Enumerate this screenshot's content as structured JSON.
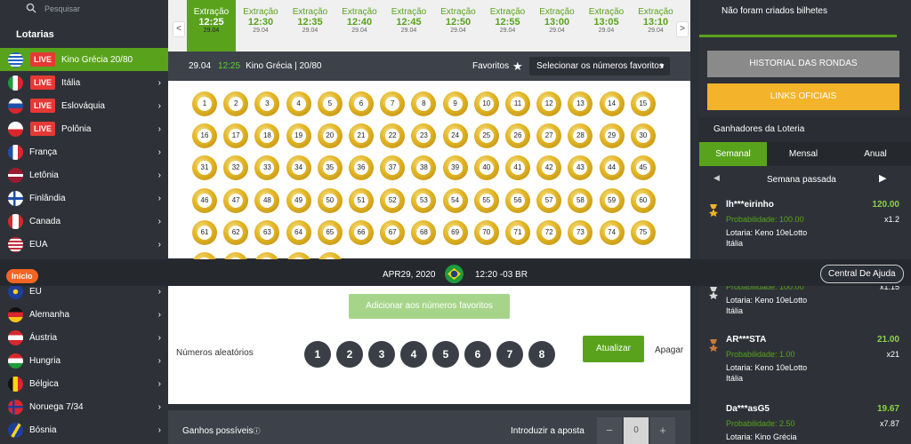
{
  "search": {
    "placeholder": "Pesquisar"
  },
  "sidebar": {
    "title": "Lotarias",
    "items": [
      {
        "name": "Kino Grécia 20/80",
        "live": "LIVE",
        "flag": "gr",
        "active": true
      },
      {
        "name": "Itália",
        "live": "LIVE",
        "flag": "it"
      },
      {
        "name": "Eslováquia",
        "live": "LIVE",
        "flag": "sk"
      },
      {
        "name": "Polônia",
        "live": "LIVE",
        "flag": "pl"
      },
      {
        "name": "França",
        "flag": "fr"
      },
      {
        "name": "Letônia",
        "flag": "lv"
      },
      {
        "name": "Finlândia",
        "flag": "fi"
      },
      {
        "name": "Canada",
        "flag": "ca"
      },
      {
        "name": "EUA",
        "flag": "us"
      },
      {
        "name": "EU",
        "flag": "eu"
      },
      {
        "name": "Alemanha",
        "flag": "de"
      },
      {
        "name": "Áustria",
        "flag": "at"
      },
      {
        "name": "Hungria",
        "flag": "hu"
      },
      {
        "name": "Bélgica",
        "flag": "be"
      },
      {
        "name": "Noruega 7/34",
        "flag": "no"
      },
      {
        "name": "Bósnia",
        "flag": "ba"
      }
    ]
  },
  "draws": [
    {
      "label": "Extração",
      "time": "12:25",
      "date": "29.04",
      "current": true
    },
    {
      "label": "Extração",
      "time": "12:30",
      "date": "29.04"
    },
    {
      "label": "Extração",
      "time": "12:35",
      "date": "29.04"
    },
    {
      "label": "Extração",
      "time": "12:40",
      "date": "29.04"
    },
    {
      "label": "Extração",
      "time": "12:45",
      "date": "29.04"
    },
    {
      "label": "Extração",
      "time": "12:50",
      "date": "29.04"
    },
    {
      "label": "Extração",
      "time": "12:55",
      "date": "29.04"
    },
    {
      "label": "Extração",
      "time": "13:00",
      "date": "29.04"
    },
    {
      "label": "Extração",
      "time": "13:05",
      "date": "29.04"
    },
    {
      "label": "Extração",
      "time": "13:10",
      "date": "29.04"
    }
  ],
  "nav": {
    "prev": "<",
    "next": ">"
  },
  "gamebar": {
    "date": "29.04",
    "time": "12:25",
    "name": "Kino Grécia | 20/80",
    "favorites": "Favoritos",
    "select_favorites": "Selecionar os números favoritos"
  },
  "balls": {
    "count": 80
  },
  "statusbar": {
    "inicio": "Início",
    "date": "APR29, 2020",
    "time": "12:20 -03 BR",
    "help": "Central De Ajuda"
  },
  "lower": {
    "add_favorites": "Adicionar aos números favoritos",
    "random_label": "Números aleatórios",
    "random_numbers": [
      "1",
      "2",
      "3",
      "4",
      "5",
      "6",
      "7",
      "8"
    ],
    "update": "Atualizar",
    "clear": "Apagar"
  },
  "ganhos": {
    "label": "Ganhos possíveis",
    "bet_label": "Introduzir a aposta",
    "minus": "−",
    "value": "0",
    "plus": "+"
  },
  "right": {
    "no_tickets": "Não foram criados bilhetes",
    "history": "HISTORIAL DAS RONDAS",
    "links": "LINKS OFICIAIS",
    "winners_title": "Ganhadores da Loteria",
    "tabs": [
      "Semanal",
      "Mensal",
      "Anual"
    ],
    "week_label": "Semana passada",
    "winners": [
      {
        "name": "lh***eirinho",
        "prob": "Probabilidade: 100.00",
        "lot": "Lotaria: Keno 10eLotto",
        "country": "Itália",
        "amount": "120.00",
        "mult": "x1.2",
        "medal": "gold"
      },
      {
        "name": "",
        "prob": "Probabilidade: 100.00",
        "lot": "Lotaria: Keno 10eLotto",
        "country": "Itália",
        "amount": "",
        "mult": "x1.15",
        "medal": "silver"
      },
      {
        "name": "AR***STA",
        "prob": "Probabilidade: 1.00",
        "lot": "Lotaria: Keno 10eLotto",
        "country": "Itália",
        "amount": "21.00",
        "mult": "x21",
        "medal": "bronze"
      },
      {
        "name": "Da***asG5",
        "prob": "Probabilidade: 2.50",
        "lot": "Lotaria: Kino Grécia",
        "country": "",
        "amount": "19.67",
        "mult": "x7.87",
        "medal": ""
      }
    ]
  },
  "colors": {
    "accent": "#59a31c",
    "live": "#e53935",
    "links": "#f3b32a",
    "inicio": "#f26522"
  }
}
